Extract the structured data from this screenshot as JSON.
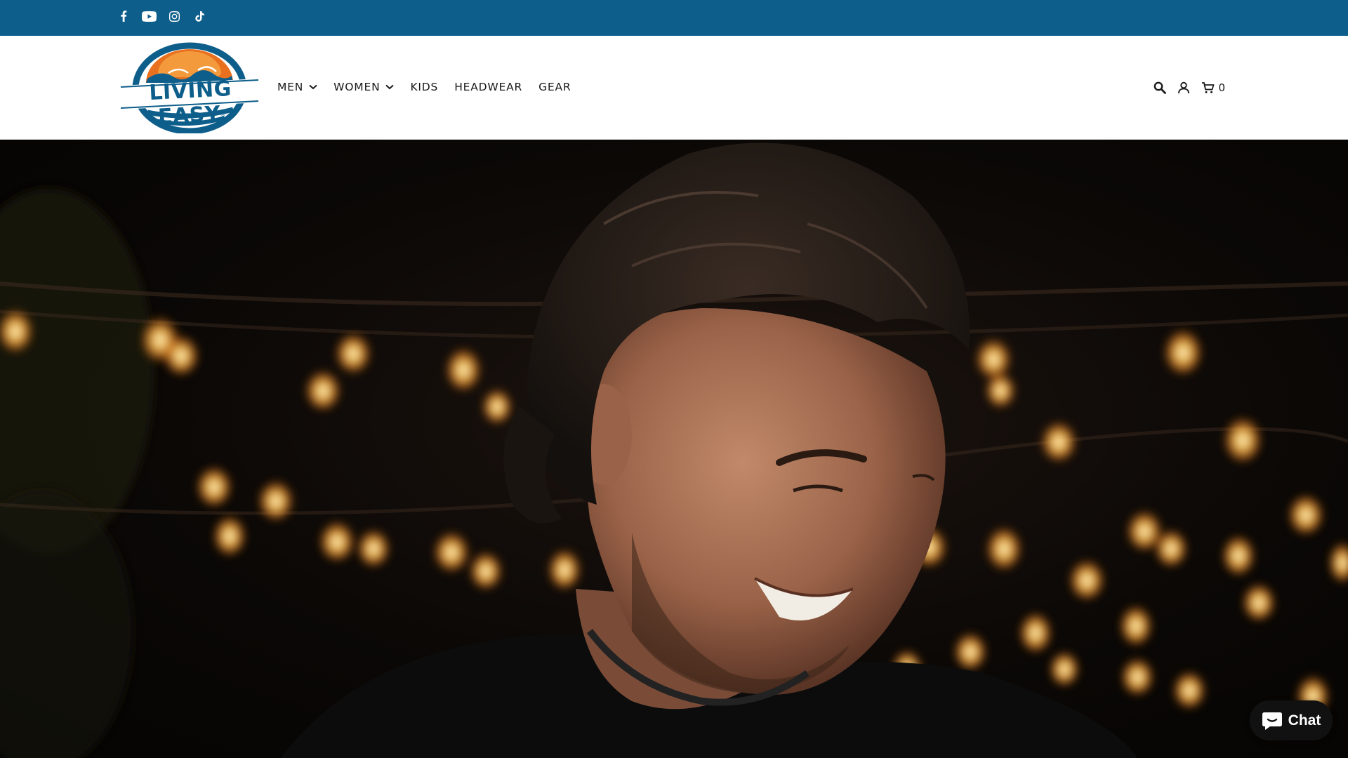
{
  "brand": {
    "name_line1": "LIVING EASY",
    "trademark": "®",
    "colors": {
      "blue": "#0d5e8a",
      "orange": "#e8701e",
      "topbar": "#0d5e8a"
    }
  },
  "social": [
    {
      "name": "facebook-icon"
    },
    {
      "name": "youtube-icon"
    },
    {
      "name": "instagram-icon"
    },
    {
      "name": "tiktok-icon"
    }
  ],
  "nav": {
    "items": [
      {
        "label": "MEN",
        "has_dropdown": true
      },
      {
        "label": "WOMEN",
        "has_dropdown": true
      },
      {
        "label": "KIDS",
        "has_dropdown": false
      },
      {
        "label": "HEADWEAR",
        "has_dropdown": false
      },
      {
        "label": "GEAR",
        "has_dropdown": false
      }
    ]
  },
  "header_actions": {
    "search_icon": "search-icon",
    "account_icon": "user-icon",
    "cart_icon": "cart-icon",
    "cart_count": "0"
  },
  "hero": {
    "image_subject": "smiling man with string lights in background"
  },
  "chat": {
    "label": "Chat"
  }
}
